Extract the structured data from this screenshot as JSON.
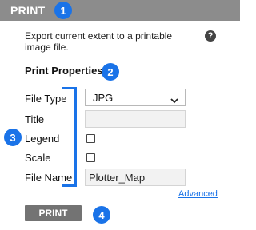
{
  "header": {
    "title": "PRINT"
  },
  "callouts": {
    "one": "1",
    "two": "2",
    "three": "3",
    "four": "4"
  },
  "description": "Export current extent to a printable image file.",
  "help_icon": "?",
  "section": {
    "title": "Print Properties"
  },
  "fields": {
    "file_type": {
      "label": "File Type",
      "value": "JPG"
    },
    "title": {
      "label": "Title",
      "value": ""
    },
    "legend": {
      "label": "Legend",
      "checked": false
    },
    "scale": {
      "label": "Scale",
      "checked": false
    },
    "file_name": {
      "label": "File Name",
      "value": "Plotter_Map"
    }
  },
  "advanced_link": "Advanced",
  "print_button": "PRINT",
  "colors": {
    "header_bg": "#8c8c8c",
    "callout": "#1a73e8",
    "print_button_bg": "#737373",
    "link": "#1a73e8"
  }
}
